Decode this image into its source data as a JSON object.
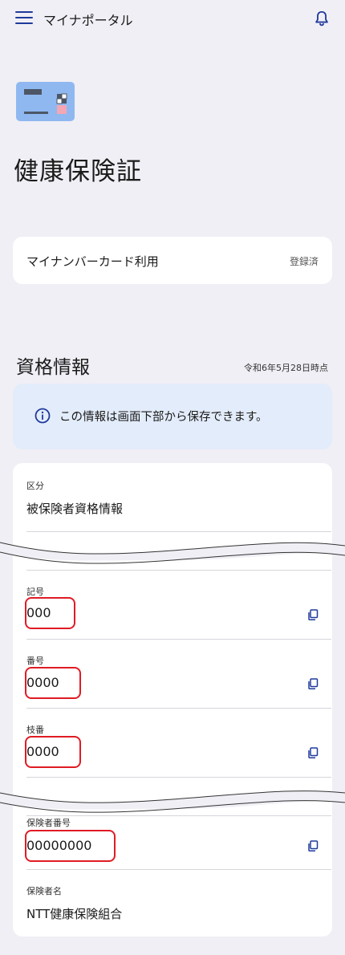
{
  "header": {
    "title": "マイナポータル",
    "menu_icon": "hamburger-menu-icon",
    "notification_icon": "bell-icon"
  },
  "page": {
    "illustration_icon": "insurance-card-icon",
    "title": "健康保険証"
  },
  "usage": {
    "label": "マイナンバーカード利用",
    "status": "登録済"
  },
  "qualification": {
    "title": "資格情報",
    "as_of": "令和6年5月28日時点",
    "notice": "この情報は画面下部から保存できます。",
    "notice_icon": "info-circle-icon"
  },
  "fields": {
    "category": {
      "label": "区分",
      "value": "被保険者資格情報"
    },
    "symbol": {
      "label": "記号",
      "value": "000"
    },
    "number": {
      "label": "番号",
      "value": "0000"
    },
    "branch": {
      "label": "枝番",
      "value": "0000"
    },
    "insurer_number": {
      "label": "保険者番号",
      "value": "00000000"
    },
    "insurer_name": {
      "label": "保険者名",
      "value": "NTT健康保険組合"
    }
  },
  "colors": {
    "accent": "#1f3a9c",
    "background": "#f0eff5",
    "highlight": "#e01b24",
    "banner": "#e3ecfa"
  }
}
